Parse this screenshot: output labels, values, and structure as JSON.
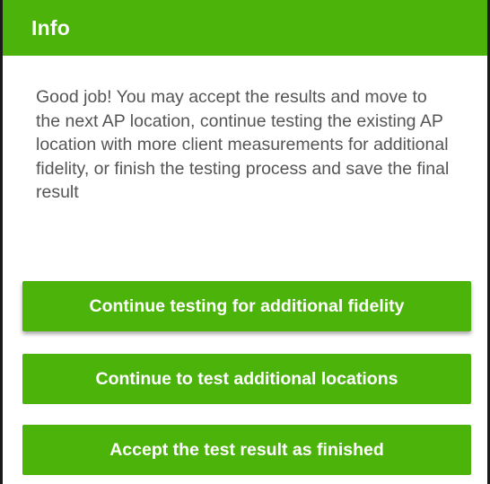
{
  "dialog": {
    "title": "Info",
    "message": "Good job!  You may accept the results and move to the next AP location, continue testing the existing AP location with more client measurements for additional fidelity, or finish the testing process and save the final result",
    "buttons": {
      "continue_fidelity": "Continue testing for additional fidelity",
      "continue_locations": "Continue to test additional locations",
      "accept_finished": "Accept the test result as finished"
    }
  },
  "colors": {
    "accent": "#4cb30b",
    "text": "#555555",
    "border": "#1a1a1a"
  }
}
